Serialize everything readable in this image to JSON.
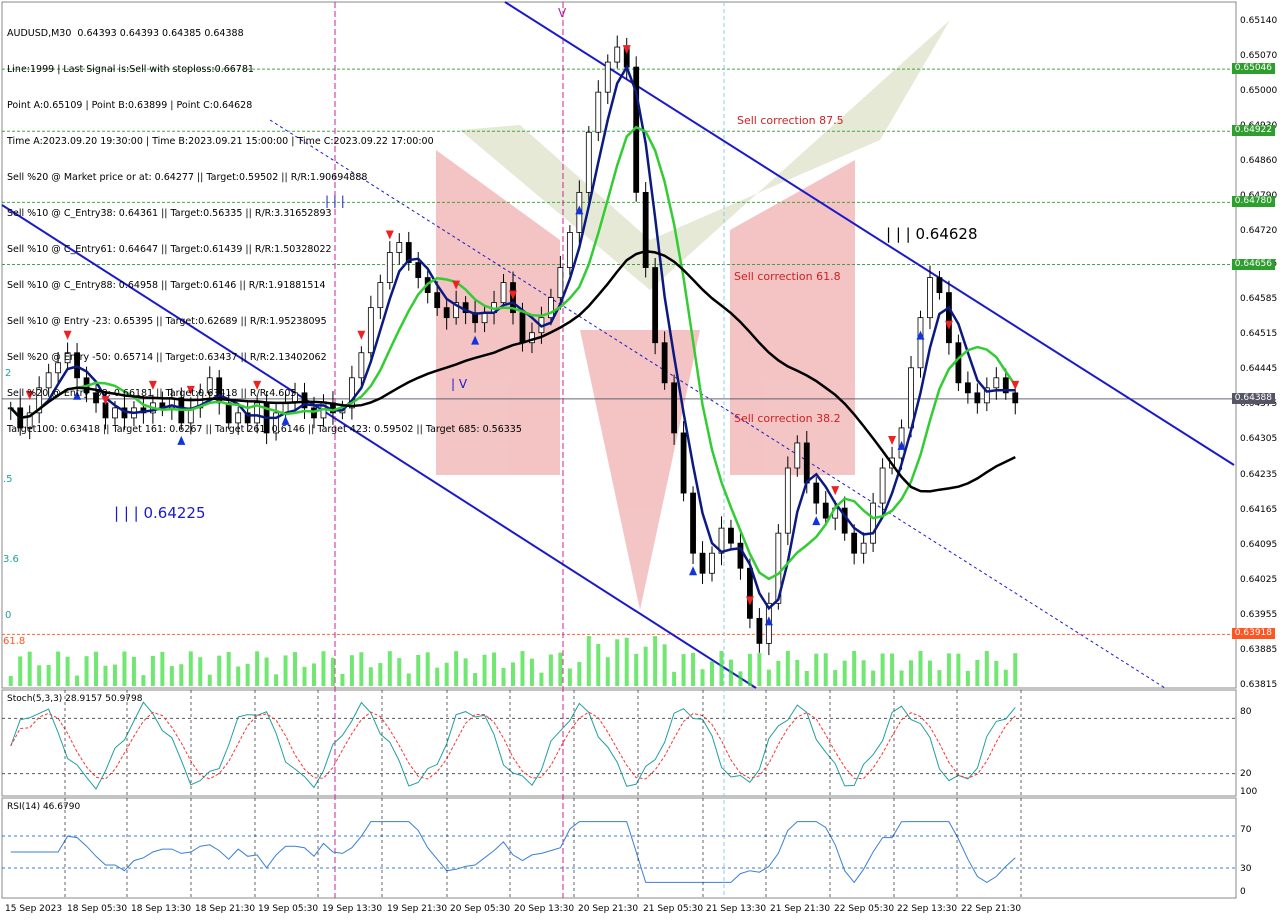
{
  "header": {
    "symbol_line": "AUDUSD,M30  0.64393 0.64393 0.64385 0.64388",
    "info_lines": [
      "Line:1999 | Last Signal is:Sell with stoploss:0.66781",
      "Point A:0.65109 | Point B:0.63899 | Point C:0.64628",
      "Time A:2023.09.20 19:30:00 | Time B:2023.09.21 15:00:00 | Time C:2023.09.22 17:00:00",
      "Sell %20 @ Market price or at: 0.64277 || Target:0.59502 || R/R:1.90694888",
      "Sell %10 @ C_Entry38: 0.64361 || Target:0.56335 || R/R:3.31652893",
      "Sell %10 @ C_Entry61: 0.64647 || Target:0.61439 || R/R:1.50328022",
      "Sell %10 @ C_Entry88: 0.64958 || Target:0.6146 || R/R:1.91881514",
      "Sell %10 @ Entry -23: 0.65395 || Target:0.62689 || R/R:1.95238095",
      "Sell %20 @ Entry -50: 0.65714 || Target:0.63437 || R/R:2.13402062",
      "Sell %20 @ Entry -88: 0.66181 || Target:0.63418 || R/R:4.605",
      "Target100: 0.63418 || Target 161: 0.6267 || Target 261: 0.6146 || Target 423: 0.59502 || Target 685: 0.56335"
    ]
  },
  "price_axis": [
    "0.65140",
    "0.65070",
    "0.65000",
    "0.64930",
    "0.64860",
    "0.64790",
    "0.64720",
    "0.64655",
    "0.64585",
    "0.64515",
    "0.64445",
    "0.64375",
    "0.64305",
    "0.64235",
    "0.64165",
    "0.64095",
    "0.64025",
    "0.63955",
    "0.63885",
    "0.63815"
  ],
  "price_tags": [
    {
      "value": "0.65046",
      "color": "#2e9e2e"
    },
    {
      "value": "0.64922",
      "color": "#2e9e2e"
    },
    {
      "value": "0.64780",
      "color": "#2e9e2e"
    },
    {
      "value": "0.64656",
      "color": "#2e9e2e"
    },
    {
      "value": "0.64388",
      "color": "#555566"
    },
    {
      "value": "0.63918",
      "color": "#ff5522"
    }
  ],
  "annotations": {
    "sell_875": "Sell correction 87.5",
    "sell_618": "Sell correction 61.8",
    "sell_382": "Sell correction 38.2",
    "point_c": "| | | 0.64628",
    "point_low": "| | | 0.64225",
    "wave_ii": "| | |",
    "wave_iv": "| V",
    "wave_v": "V",
    "left_2": "2",
    "left_5": ".5",
    "left_36": "3.6",
    "left_0": "0",
    "left_618": "61.8"
  },
  "time_axis": [
    "15 Sep 2023",
    "18 Sep 05:30",
    "18 Sep 13:30",
    "18 Sep 21:30",
    "19 Sep 05:30",
    "19 Sep 13:30",
    "19 Sep 21:30",
    "20 Sep 05:30",
    "20 Sep 13:30",
    "20 Sep 21:30",
    "21 Sep 05:30",
    "21 Sep 13:30",
    "21 Sep 21:30",
    "22 Sep 05:30",
    "22 Sep 13:30",
    "22 Sep 21:30"
  ],
  "indicators": {
    "stoch_title": "Stoch(5,3,3) 28.9157 50.9798",
    "stoch_levels": [
      "80",
      "20"
    ],
    "rsi_title": "RSI(14) 46.6790",
    "rsi_levels": [
      "100",
      "70",
      "30",
      "0"
    ]
  },
  "colors": {
    "candle": "#000000",
    "ma_fast": "#0a1a80",
    "ma_mid": "#33cc33",
    "ma_slow": "#000000",
    "channel": "#1a1acc",
    "level": "#2e9e2e",
    "stoch_main": "#20a0a0",
    "stoch_signal": "#ff3333",
    "rsi": "#3a7fd6",
    "volume": "#33dd33",
    "sell_arrow": "#ee2222",
    "buy_arrow": "#1133dd"
  },
  "chart_data": {
    "type": "candlestick",
    "symbol": "AUDUSD",
    "timeframe": "M30",
    "ylim": [
      0.63815,
      0.6514
    ],
    "close_path": [
      0.6437,
      0.6433,
      0.6436,
      0.6441,
      0.6444,
      0.6446,
      0.6448,
      0.6443,
      0.644,
      0.6438,
      0.6435,
      0.6437,
      0.6435,
      0.6437,
      0.6436,
      0.6438,
      0.6437,
      0.6439,
      0.6434,
      0.6437,
      0.644,
      0.6443,
      0.6438,
      0.6434,
      0.6436,
      0.6434,
      0.6438,
      0.6432,
      0.6436,
      0.6438,
      0.644,
      0.6437,
      0.6435,
      0.6438,
      0.6436,
      0.6437,
      0.6443,
      0.6448,
      0.6457,
      0.6462,
      0.6468,
      0.647,
      0.6466,
      0.6463,
      0.646,
      0.6457,
      0.6455,
      0.6458,
      0.6456,
      0.6454,
      0.6456,
      0.6458,
      0.6462,
      0.6456,
      0.645,
      0.6452,
      0.6455,
      0.6459,
      0.6465,
      0.6472,
      0.648,
      0.6492,
      0.65,
      0.6506,
      0.6509,
      0.6505,
      0.648,
      0.6465,
      0.645,
      0.6442,
      0.6432,
      0.642,
      0.6408,
      0.6404,
      0.6408,
      0.6413,
      0.641,
      0.6405,
      0.6395,
      0.639,
      0.6398,
      0.6412,
      0.6425,
      0.643,
      0.6422,
      0.6418,
      0.6415,
      0.6417,
      0.6412,
      0.6408,
      0.641,
      0.6418,
      0.6425,
      0.6427,
      0.6433,
      0.6445,
      0.6455,
      0.6463,
      0.646,
      0.645,
      0.6442,
      0.644,
      0.6438,
      0.6441,
      0.6443,
      0.644,
      0.6438
    ]
  }
}
